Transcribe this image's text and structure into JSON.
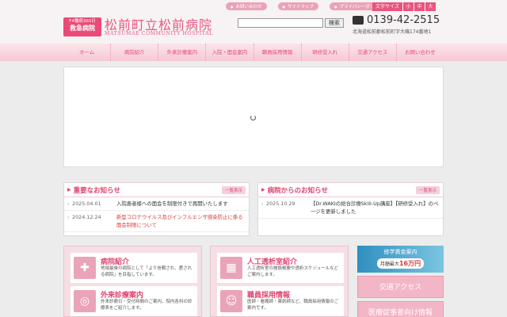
{
  "header": {
    "badge_line1": "F4種病365日",
    "badge_line2": "救急病院",
    "title": "松前町立松前病院",
    "subtitle": "MATSUMAE COMMUNITY HOSPITAL",
    "util_links": [
      "お問い合わせ",
      "サイトマップ",
      "プライバシーポリシー"
    ],
    "font_size_label": "文字サイズ",
    "font_sizes": [
      "小",
      "中",
      "大"
    ],
    "search_button": "検索",
    "search_placeholder": "",
    "tel": "0139-42-2515",
    "address": "北海道松前郡松前町字大磯174番地1"
  },
  "nav": [
    "ホーム",
    "病院紹介",
    "外来診療案内",
    "入院・面会案内",
    "職員採用情報",
    "研修受入れ",
    "交通アクセス",
    "お問い合わせ"
  ],
  "news_important": {
    "title": "重要なお知らせ",
    "more": "一覧表示",
    "items": [
      {
        "date": "2025.04.01",
        "text": "入院患者様への面会を制限付きで再開いたします",
        "red": false
      },
      {
        "date": "2024.12.24",
        "text": "新型コロナウイルス及びインフルエンザ感染防止に係る面会制限について",
        "red": true
      }
    ]
  },
  "news_hospital": {
    "title": "病院からのお知らせ",
    "more": "一覧表示",
    "items": [
      {
        "date": "2025.10.29",
        "text": "【Dr.WAKIの総合診療Skill-Up講座】【研修受入れ】のページを更新しました",
        "red": false
      }
    ]
  },
  "cards": [
    {
      "title": "病院紹介",
      "desc": "地域最後の病院として「より信頼され、愛される病院」を目指しています。",
      "icon": "hospital-icon"
    },
    {
      "title": "外来診療案内",
      "desc": "外来診療日・受付時間のご案内、院内各科の診療表をご紹介します。",
      "icon": "stethoscope-icon"
    },
    {
      "title": "人工透析室紹介",
      "desc": "人工透析室の施設概要や透析スケジュールなどご案内します。",
      "icon": "dialysis-icon"
    },
    {
      "title": "職員採用情報",
      "desc": "医師・看護師・薬剤師など、職員採用情報のご案内です。",
      "icon": "staff-icon"
    }
  ],
  "side": {
    "fund_title": "修学資金案内",
    "fund_sub_prefix": "月額最大",
    "fund_amount": "16万円",
    "access": "交通アクセス",
    "next": "医療従事者向け情報"
  }
}
